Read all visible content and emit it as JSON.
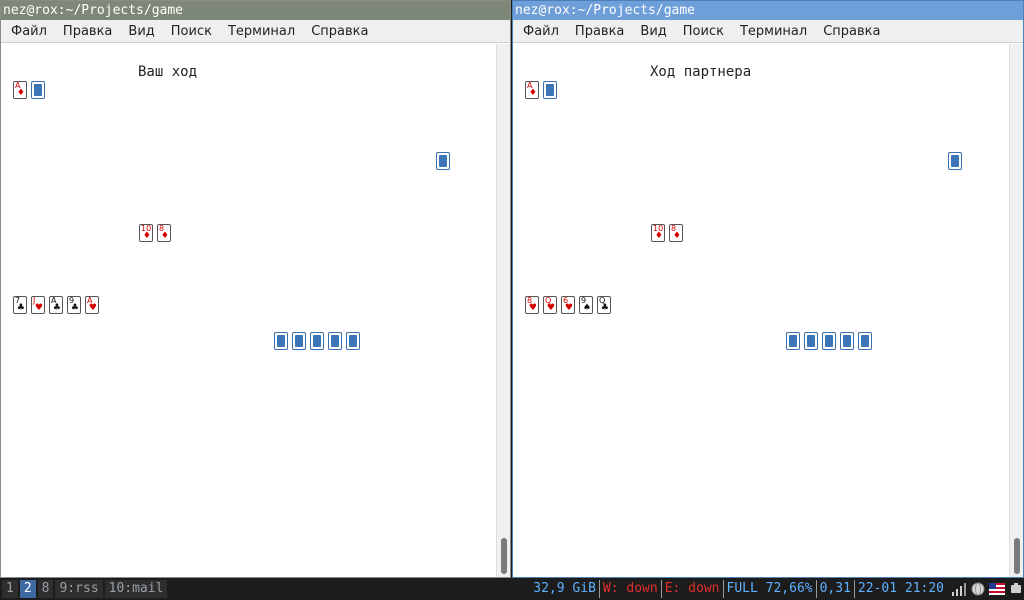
{
  "windows": {
    "left": {
      "title": "nez@rox:~/Projects/game",
      "menu": [
        "Файл",
        "Правка",
        "Вид",
        "Поиск",
        "Терминал",
        "Справка"
      ],
      "status": "Ваш ход",
      "rows": {
        "top": [
          {
            "rank": "A",
            "suit": "♦",
            "color": "red"
          },
          {
            "back": true
          }
        ],
        "right": [
          {
            "back": true
          }
        ],
        "table": [
          {
            "rank": "10",
            "suit": "♦",
            "color": "red"
          },
          {
            "rank": "8",
            "suit": "♦",
            "color": "red"
          }
        ],
        "hand": [
          {
            "rank": "7",
            "suit": "♣",
            "color": "black"
          },
          {
            "rank": "J",
            "suit": "♥",
            "color": "red"
          },
          {
            "rank": "A",
            "suit": "♣",
            "color": "black"
          },
          {
            "rank": "9",
            "suit": "♣",
            "color": "black"
          },
          {
            "rank": "A",
            "suit": "♥",
            "color": "red"
          }
        ],
        "bottom": [
          {
            "back": true
          },
          {
            "back": true
          },
          {
            "back": true
          },
          {
            "back": true
          },
          {
            "back": true
          }
        ]
      }
    },
    "right": {
      "title": "nez@rox:~/Projects/game",
      "menu": [
        "Файл",
        "Правка",
        "Вид",
        "Поиск",
        "Терминал",
        "Справка"
      ],
      "status": "Ход партнера",
      "rows": {
        "top": [
          {
            "rank": "A",
            "suit": "♦",
            "color": "red"
          },
          {
            "back": true
          }
        ],
        "right": [
          {
            "back": true
          }
        ],
        "table": [
          {
            "rank": "10",
            "suit": "♦",
            "color": "red"
          },
          {
            "rank": "8",
            "suit": "♦",
            "color": "red"
          }
        ],
        "hand": [
          {
            "rank": "8",
            "suit": "♥",
            "color": "red"
          },
          {
            "rank": "Q",
            "suit": "♥",
            "color": "red"
          },
          {
            "rank": "6",
            "suit": "♥",
            "color": "red"
          },
          {
            "rank": "9",
            "suit": "♠",
            "color": "black"
          },
          {
            "rank": "Q",
            "suit": "♣",
            "color": "black"
          }
        ],
        "bottom": [
          {
            "back": true
          },
          {
            "back": true
          },
          {
            "back": true
          },
          {
            "back": true
          },
          {
            "back": true
          }
        ]
      }
    }
  },
  "taskbar": {
    "workspaces": [
      {
        "label": "1",
        "active": false
      },
      {
        "label": "2",
        "active": true
      },
      {
        "label": "8",
        "active": false
      },
      {
        "label": "9:rss",
        "active": false
      },
      {
        "label": "10:mail",
        "active": false
      }
    ],
    "stats": [
      {
        "text": "32,9 GiB",
        "color": "#5fb0ff"
      },
      {
        "text": "W: down",
        "color": "#e23030"
      },
      {
        "text": "E: down",
        "color": "#e23030"
      },
      {
        "text": "FULL 72,66%",
        "color": "#5fb0ff"
      },
      {
        "text": "0,31",
        "color": "#5fb0ff"
      },
      {
        "text": "22-01 21:20",
        "color": "#5fb0ff"
      }
    ],
    "tray_icons": [
      "signal-icon",
      "globe-icon",
      "flag-us-icon",
      "power-icon"
    ]
  }
}
